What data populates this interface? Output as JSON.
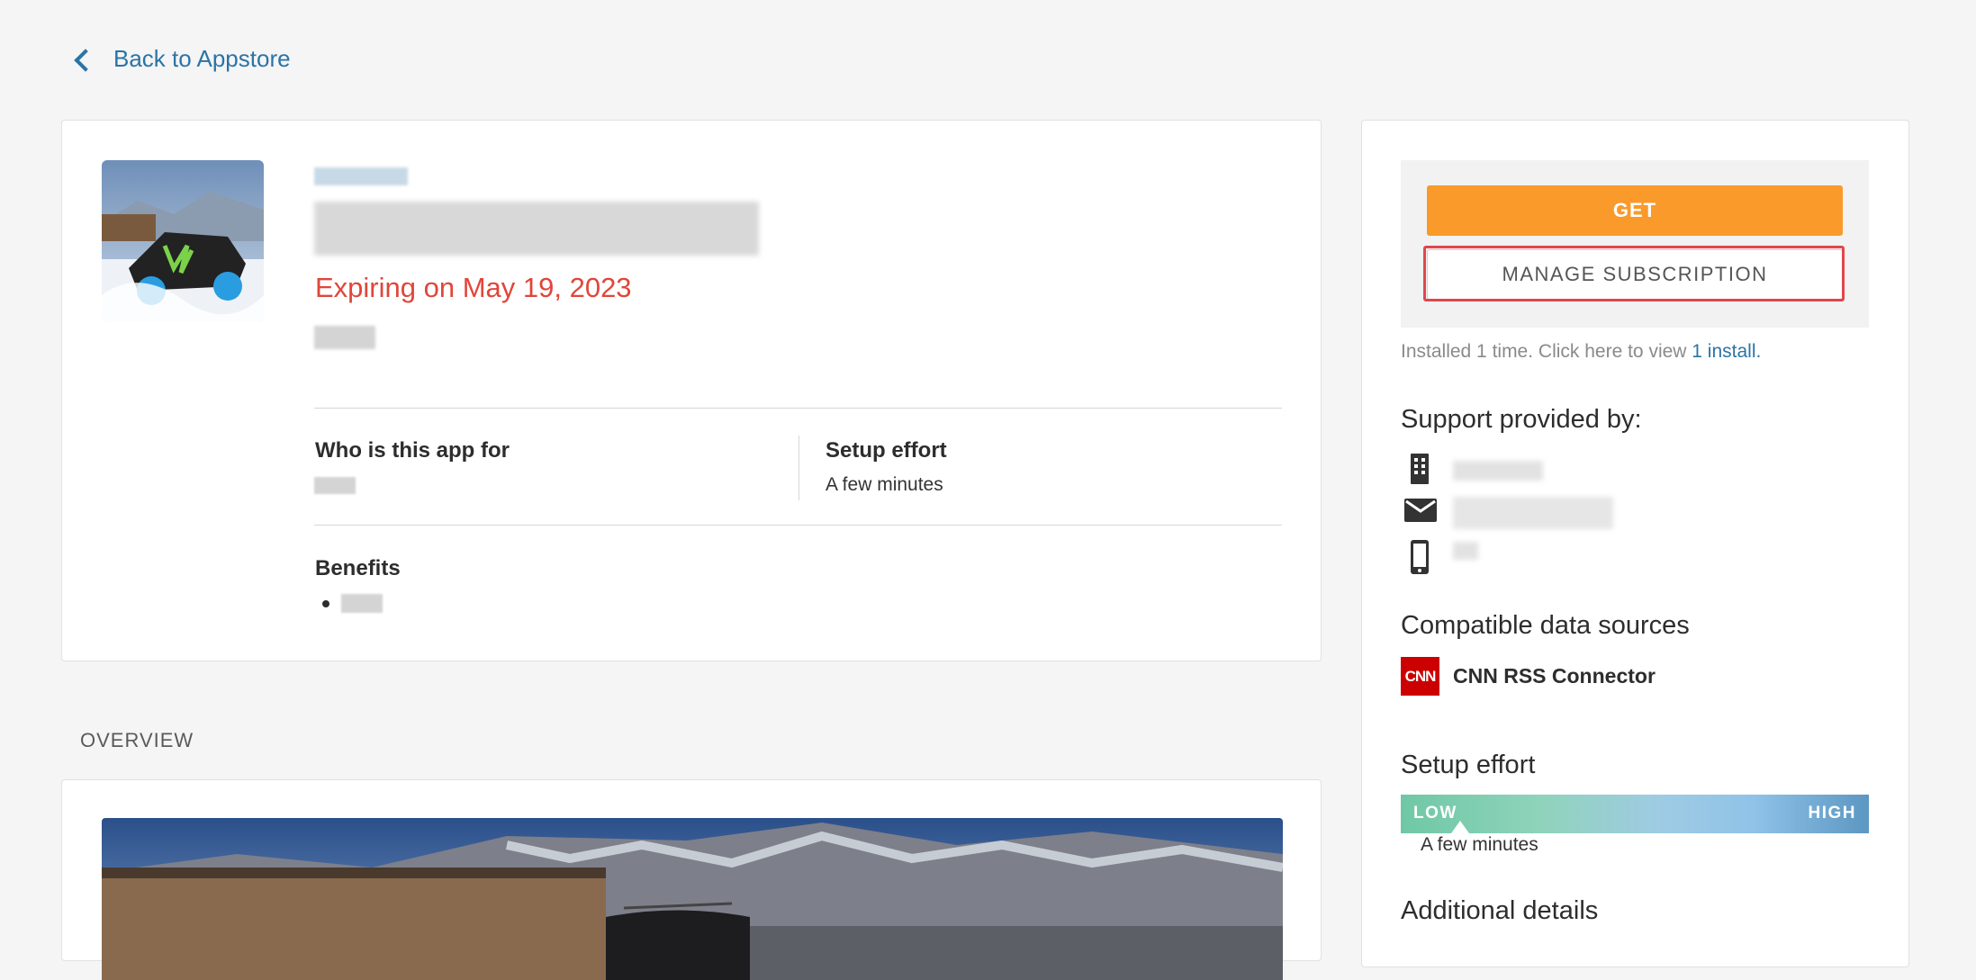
{
  "nav": {
    "back_label": "Back to Appstore"
  },
  "app": {
    "expiring_text": "Expiring on May 19, 2023",
    "who_label": "Who is this app for",
    "setup_label": "Setup effort",
    "setup_value": "A few minutes",
    "benefits_label": "Benefits"
  },
  "overview": {
    "label": "OVERVIEW"
  },
  "sidebar": {
    "get_label": "GET",
    "manage_label": "MANAGE SUBSCRIPTION",
    "installed_prefix": "Installed 1 time. Click here to view ",
    "installed_link": "1 install.",
    "support_title": "Support provided by:",
    "compat_title": "Compatible data sources",
    "compat_logo_text": "CNN",
    "compat_source": "CNN RSS Connector",
    "effort_title": "Setup effort",
    "effort_low": "LOW",
    "effort_high": "HIGH",
    "effort_value": "A few minutes",
    "additional_title": "Additional details"
  },
  "colors": {
    "accent_link": "#2b74a6",
    "get_button": "#f99a2a",
    "expiring": "#e0463a",
    "highlight_box": "#e0474c"
  }
}
